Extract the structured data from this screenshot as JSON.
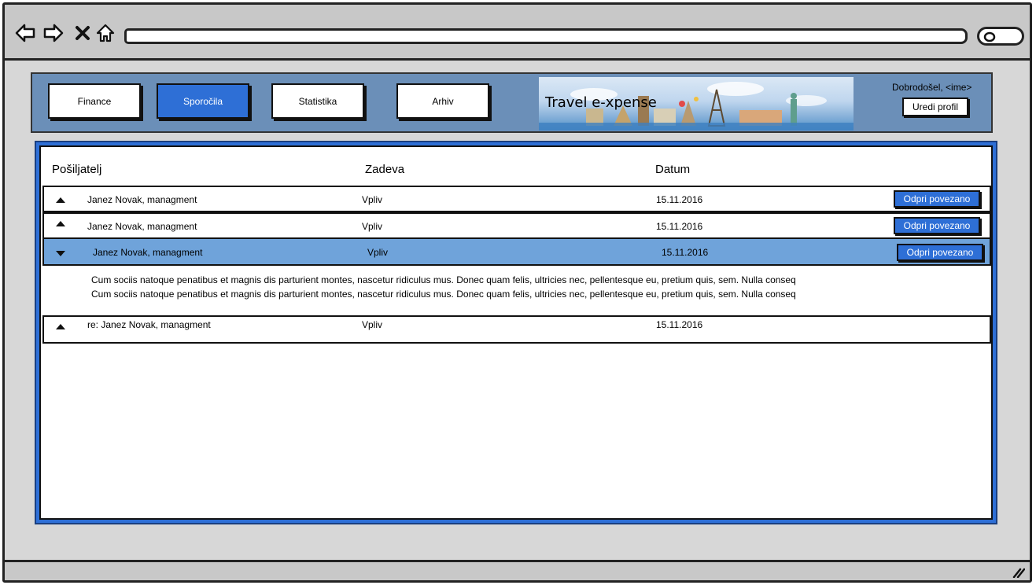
{
  "colors": {
    "accent": "#2e6fd6",
    "header_bg": "#6b8fb8",
    "selected_row": "#6fa3da",
    "frame": "#d7d7d7"
  },
  "browser": {
    "icons": [
      "back-icon",
      "forward-icon",
      "close-icon",
      "home-icon",
      "search-icon"
    ],
    "url": ""
  },
  "header": {
    "nav": [
      {
        "label": "Finance",
        "active": false
      },
      {
        "label": "Sporočila",
        "active": true
      },
      {
        "label": "Statistika",
        "active": false
      },
      {
        "label": "Arhiv",
        "active": false
      }
    ],
    "banner_title": "Travel e-xpense",
    "welcome": "Dobrodošel, <ime>",
    "edit_profile": "Uredi profil"
  },
  "messages": {
    "columns": [
      "Pošiljatelj",
      "Zadeva",
      "Datum"
    ],
    "rows": [
      {
        "sender": "Janez Novak, managment",
        "subject": "Vpliv",
        "date": "15.11.2016",
        "action": "Odpri povezano",
        "expanded": false
      },
      {
        "sender": "Janez Novak, managment",
        "subject": "Vpliv",
        "date": "15.11.2016",
        "action": "Odpri povezano",
        "expanded": false
      },
      {
        "sender": "Janez Novak, managment",
        "subject": "Vpliv",
        "date": "15.11.2016",
        "action": "Odpri povezano",
        "expanded": true
      },
      {
        "sender": "re: Janez Novak, managment",
        "subject": "Vpliv",
        "date": "15.11.2016",
        "action": "",
        "expanded": false
      }
    ],
    "expanded_body": [
      "Cum sociis natoque penatibus et magnis dis parturient montes, nascetur ridiculus mus. Donec quam felis, ultricies nec, pellentesque eu, pretium quis, sem. Nulla conseq",
      "Cum sociis natoque penatibus et magnis dis parturient montes, nascetur ridiculus mus. Donec quam felis, ultricies nec, pellentesque eu, pretium quis, sem. Nulla conseq"
    ]
  }
}
